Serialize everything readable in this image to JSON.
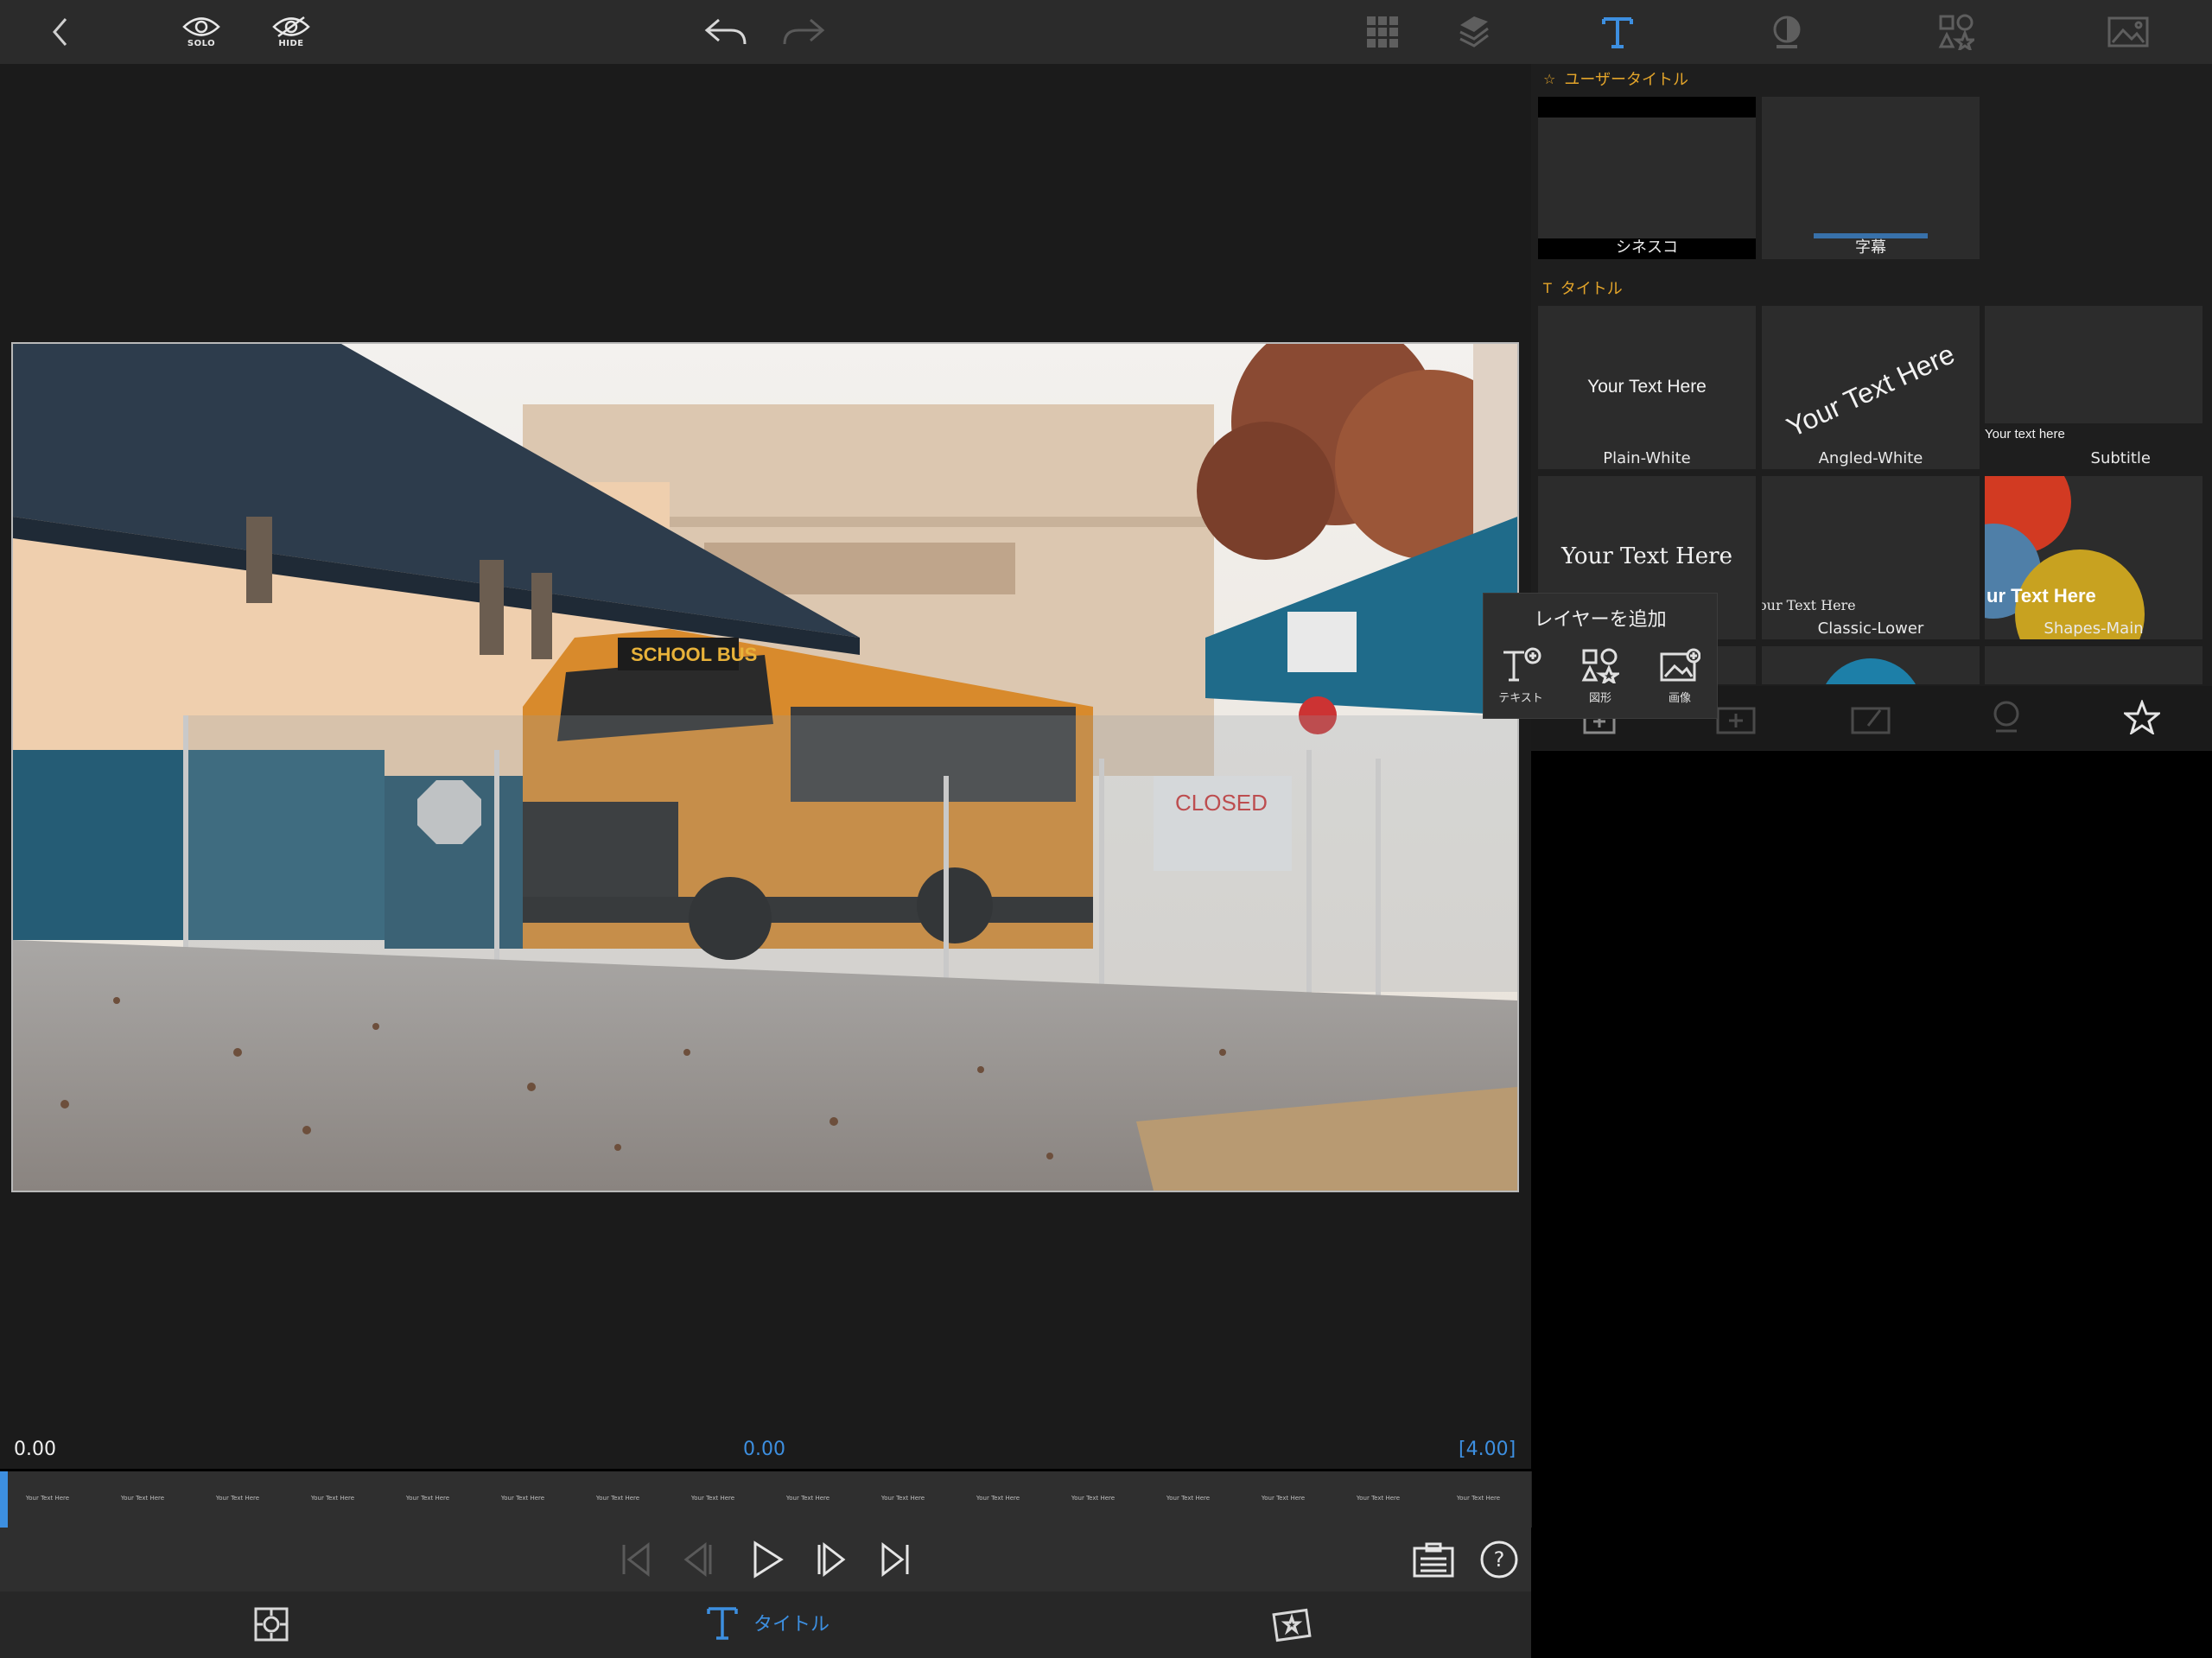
{
  "toolbar": {
    "solo_label": "SOLO",
    "hide_label": "HIDE"
  },
  "library": {
    "user_section_title": "ユーザータイトル",
    "user_tiles": [
      "シネスコ",
      "字幕"
    ],
    "titles_section_title": "タイトル",
    "title_tiles": [
      {
        "name": "Plain-White",
        "preview": "Your Text Here"
      },
      {
        "name": "Angled-White",
        "preview": "Your Text Here"
      },
      {
        "name": "Subtitle",
        "preview": "Your text here"
      },
      {
        "name": "",
        "preview": "Your Text Here"
      },
      {
        "name": "Classic-Lower",
        "preview": "our Text Here"
      },
      {
        "name": "Shapes-Main",
        "preview": "ur Text Here"
      }
    ]
  },
  "popup": {
    "title": "レイヤーを追加",
    "items": [
      "テキスト",
      "図形",
      "画像"
    ]
  },
  "timeline": {
    "current_time": "0.00",
    "playhead_time": "0.00",
    "duration": "[4.00]",
    "frame_text": "Your Text Here"
  },
  "bottom": {
    "active_tab_label": "タイトル"
  },
  "colors": {
    "accent_blue": "#3d8fe0",
    "section_orange": "#e3a42a",
    "panel_dark": "#1e1e1e"
  },
  "icons": [
    "back-chevron-icon",
    "solo-eye-icon",
    "hide-eye-icon",
    "undo-icon",
    "redo-icon",
    "grid-icon",
    "layers-icon",
    "title-text-icon",
    "color-icon",
    "shapes-icon",
    "image-icon",
    "star-icon"
  ]
}
